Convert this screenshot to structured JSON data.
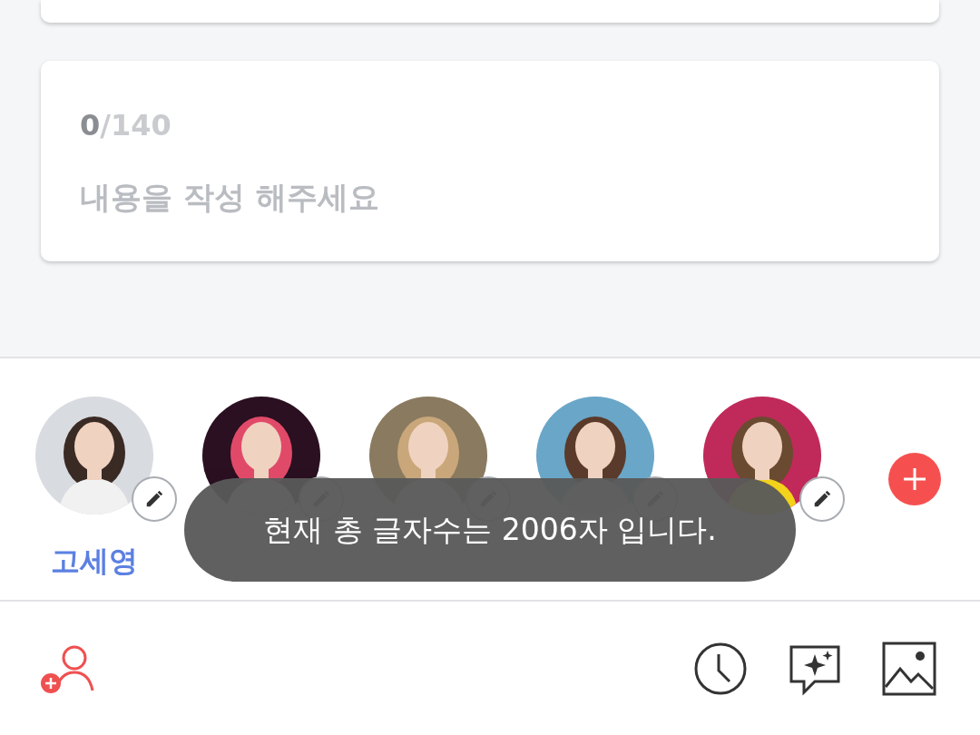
{
  "editor": {
    "count": "0",
    "limit": "/140",
    "placeholder": "내용을 작성 해주세요"
  },
  "avatars": [
    {
      "name": "고세영",
      "kind": "picture"
    },
    {
      "kind": "picture"
    },
    {
      "kind": "picture"
    },
    {
      "kind": "picture"
    },
    {
      "kind": "picture"
    }
  ],
  "toast": "현재 총 글자수는 2006자 입니다."
}
